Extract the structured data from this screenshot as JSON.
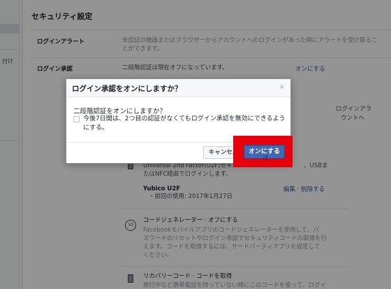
{
  "sidebar": {
    "fragment": "付け"
  },
  "page": {
    "title": "セキュリティ設定",
    "login_alert": {
      "label": "ログインアラート",
      "desc_line1": "未認証の機器またはブラウザーからアカウントへのログインがあった時にアラートを受け取るこ",
      "desc_line2": "とができます。"
    },
    "login_approval": {
      "label": "ログイン承認",
      "desc_line1": "二段階認証は現在オフになっています。",
      "action": "オンにする",
      "frag_right1": "ログインアラ",
      "frag_right2": "ウントへ",
      "u2f_line1": "Universal 2nd Factor(U2F)セキュ",
      "u2f_line1b": "、USBま",
      "u2f_line2": "たはNFC経由でログインします。",
      "device_name": "Yubico U2F",
      "device_last_used": "・前回の使用: 2017年1月27日",
      "device_actions": "編集 · 削除する",
      "code_gen_title": "コードジェネレーター · オフにする",
      "code_gen_desc1": "Facebookモバイルアプリのコードジェネレーターを使用して、パ",
      "code_gen_desc2": "スワードのリセットやログイン承認でセキュリティコードの取得を行",
      "code_gen_desc3": "えます。コードを取得するには、サードパーティアプリを設定して",
      "code_gen_desc4": "ください。",
      "recovery_title": "リカバリーコード · コードを取得",
      "recovery_desc": "旅行中など携帯電話を持っていない時にこのコードを使って、ログイ"
    }
  },
  "dialog": {
    "title": "ログイン承認をオンにしますか？",
    "close_glyph": "×",
    "question": "二段階認証をオンにしますか？",
    "checkbox_label": "今後7日間は、2つ目の認証がなくてもログイン承認を無効にできるようにする。",
    "cancel_label": "キャンセル",
    "confirm_label": "オンにする"
  },
  "colors": {
    "primary": "#4267b2",
    "highlight": "#e8000b"
  }
}
